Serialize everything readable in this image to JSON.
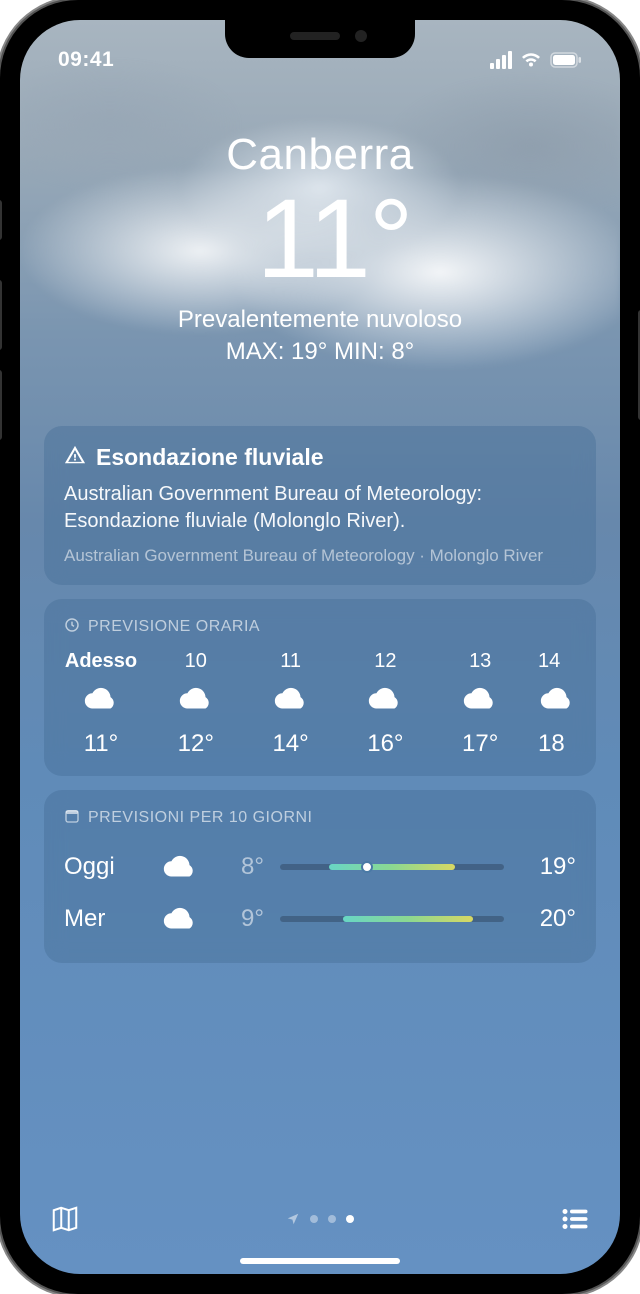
{
  "status": {
    "time": "09:41"
  },
  "hero": {
    "city": "Canberra",
    "temp": "11°",
    "condition": "Prevalentemente nuvoloso",
    "hilo": "MAX: 19°  MIN: 8°"
  },
  "alert": {
    "title": "Esondazione fluviale",
    "body": "Australian Government Bureau of Meteorology: Esondazione fluviale (Molonglo River).",
    "source": "Australian Government Bureau of Meteorology · Molonglo River"
  },
  "hourly": {
    "header": "PREVISIONE ORARIA",
    "items": [
      {
        "label": "Adesso",
        "temp": "11°",
        "icon": "cloud"
      },
      {
        "label": "10",
        "temp": "12°",
        "icon": "cloud"
      },
      {
        "label": "11",
        "temp": "14°",
        "icon": "cloud"
      },
      {
        "label": "12",
        "temp": "16°",
        "icon": "cloud"
      },
      {
        "label": "13",
        "temp": "17°",
        "icon": "cloud"
      },
      {
        "label": "14",
        "temp": "18",
        "icon": "cloud"
      }
    ]
  },
  "daily": {
    "header": "PREVISIONI PER 10 GIORNI",
    "items": [
      {
        "day": "Oggi",
        "icon": "cloud",
        "low": "8°",
        "high": "19°",
        "fillLeft": 22,
        "fillWidth": 56,
        "dotLeft": 36
      },
      {
        "day": "Mer",
        "icon": "cloud",
        "low": "9°",
        "high": "20°",
        "fillLeft": 28,
        "fillWidth": 58,
        "dotLeft": null
      }
    ]
  },
  "pager": {
    "count": 4,
    "activeIndex": 3
  }
}
